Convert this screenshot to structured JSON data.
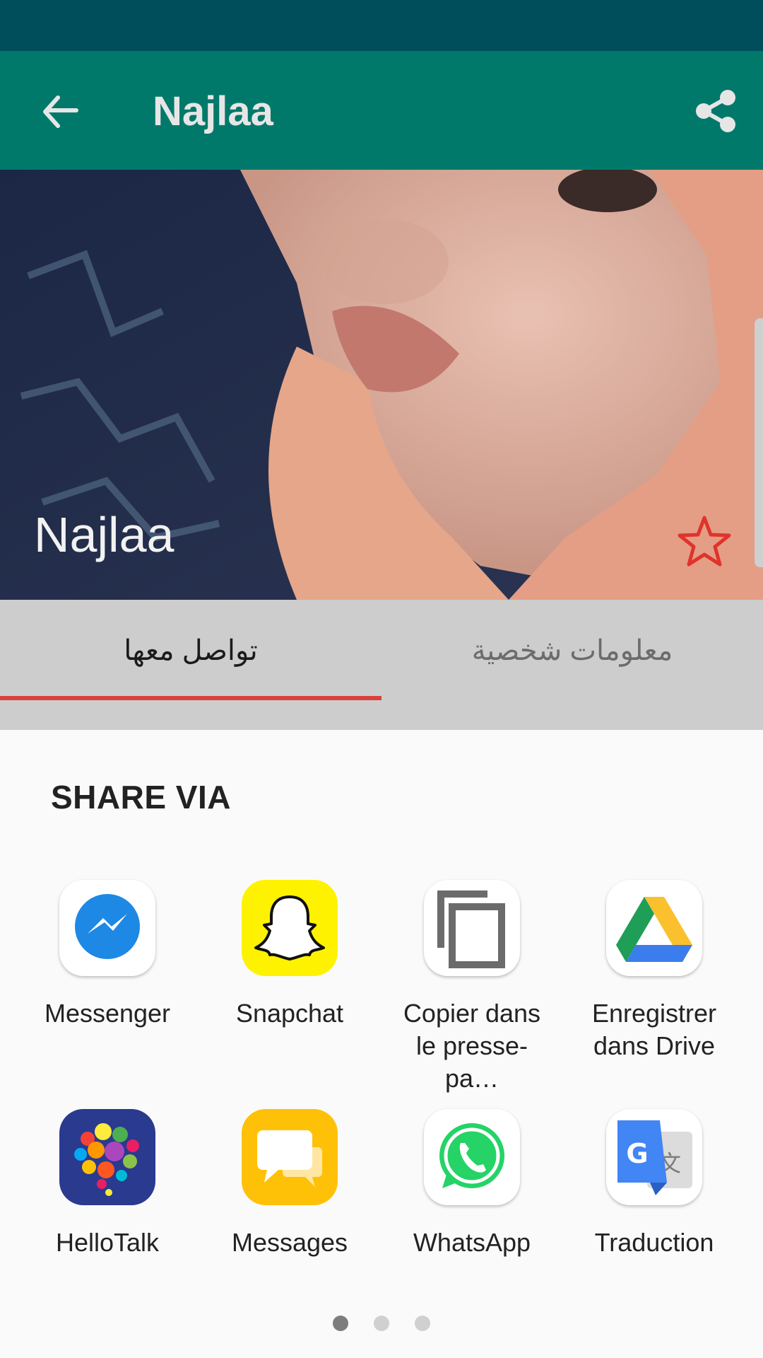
{
  "app_bar": {
    "title": "Najlaa",
    "back_icon": "arrow-back-icon",
    "share_icon": "share-icon",
    "color": "#00796b"
  },
  "profile": {
    "name": "Najlaa",
    "favorite_icon": "star-outline-icon",
    "favorite_color": "#e0332c"
  },
  "tabs": [
    {
      "label": "تواصل معها",
      "selected": true
    },
    {
      "label": "معلومات شخصية",
      "selected": false
    }
  ],
  "share_sheet": {
    "title": "SHARE VIA",
    "apps": [
      {
        "label": "Messenger",
        "icon": "messenger-icon"
      },
      {
        "label": "Snapchat",
        "icon": "snapchat-icon"
      },
      {
        "label": "Copier dans le presse-pa…",
        "icon": "copy-icon"
      },
      {
        "label": "Enregistrer dans Drive",
        "icon": "google-drive-icon"
      },
      {
        "label": "HelloTalk",
        "icon": "hellotalk-icon"
      },
      {
        "label": "Messages",
        "icon": "messages-icon"
      },
      {
        "label": "WhatsApp",
        "icon": "whatsapp-icon"
      },
      {
        "label": "Traduction",
        "icon": "google-translate-icon"
      }
    ],
    "page_count": 3,
    "current_page": 1
  }
}
